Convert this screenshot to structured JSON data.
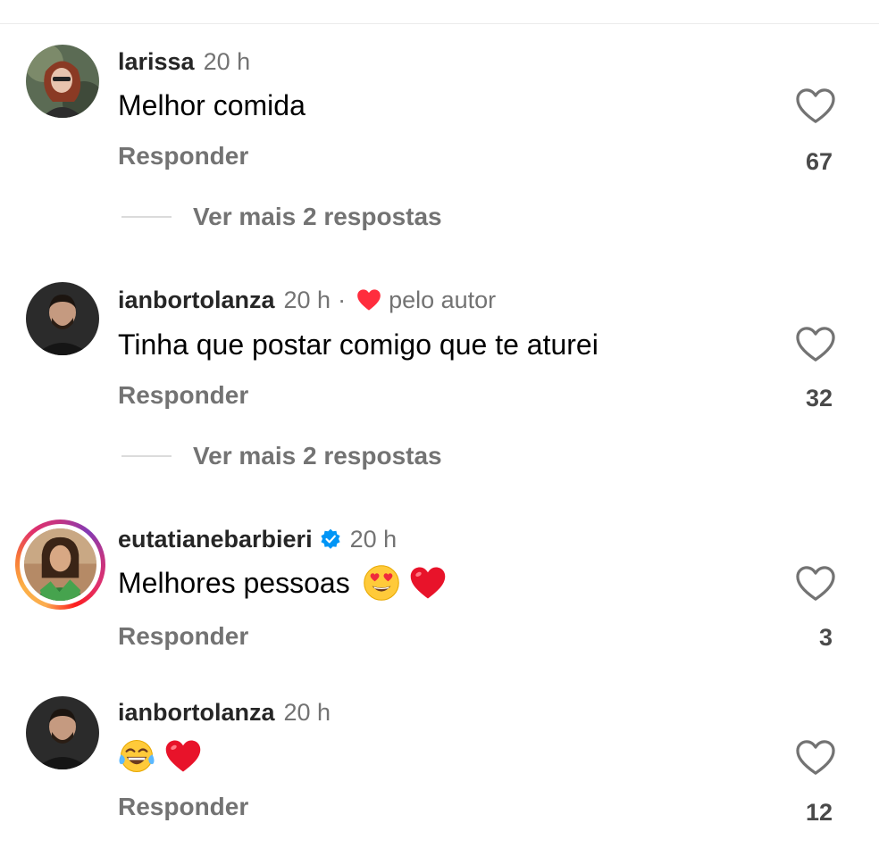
{
  "comments": [
    {
      "username": "larissa",
      "time": "20 h",
      "text": "Melhor comida",
      "reply_label": "Responder",
      "likes": "67",
      "more_replies": "Ver mais 2 respostas"
    },
    {
      "username": "ianbortolanza",
      "time": "20 h",
      "separator": "·",
      "liked_by_author": "pelo autor",
      "text": "Tinha que postar comigo que te aturei",
      "reply_label": "Responder",
      "likes": "32",
      "more_replies": "Ver mais 2 respostas"
    },
    {
      "username": "eutatianebarbieri",
      "verified": true,
      "has_story": true,
      "time": "20 h",
      "text": "Melhores pessoas",
      "emojis": [
        "heart-eyes-emoji",
        "red-heart-emoji"
      ],
      "reply_label": "Responder",
      "likes": "3"
    },
    {
      "username": "ianbortolanza",
      "time": "20 h",
      "text": "",
      "emojis": [
        "tears-of-joy-emoji",
        "red-heart-emoji"
      ],
      "reply_label": "Responder",
      "likes": "12"
    }
  ],
  "colors": {
    "secondary_text": "#737373",
    "author_heart": "#ff2d3d",
    "verified_badge": "#0095f6"
  }
}
